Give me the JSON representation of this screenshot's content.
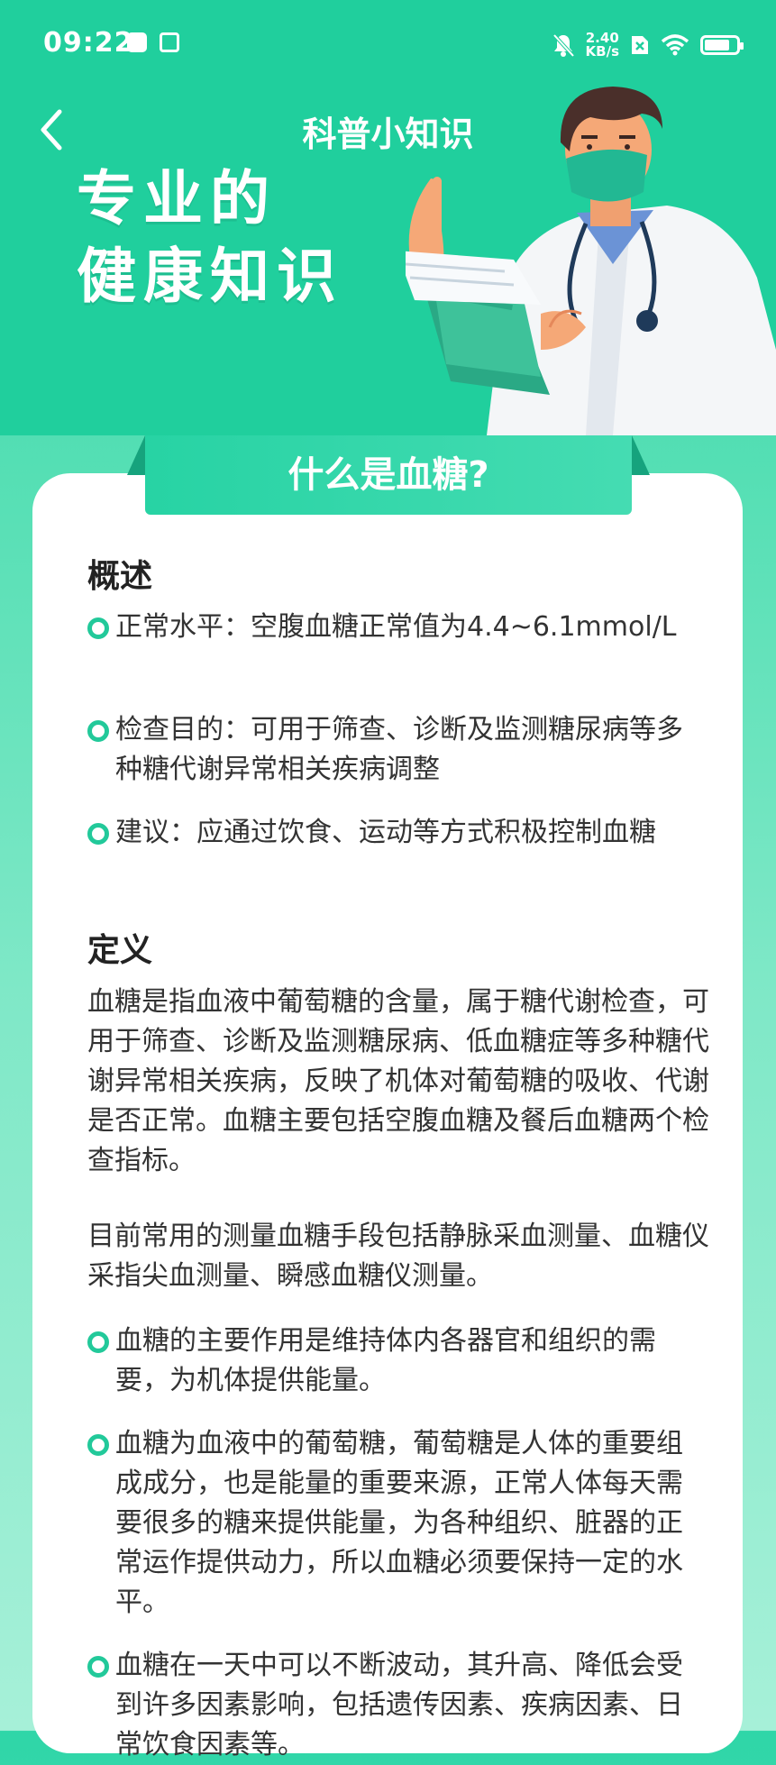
{
  "status_bar": {
    "time": "09:22",
    "speed_value": "2.40",
    "speed_unit": "KB/s",
    "battery_level": 0.8
  },
  "nav": {
    "title": "科普小知识",
    "back_icon": "chevron-left-icon"
  },
  "hero": {
    "slogan_line1": "专业的",
    "slogan_line2": "健康知识"
  },
  "article": {
    "title": "什么是血糖?",
    "overview_heading": "概述",
    "overview_items": [
      "正常水平：空腹血糖正常值为4.4~6.1mmol/L",
      "检查目的：可用于筛查、诊断及监测糖尿病等多种糖代谢异常相关疾病调整",
      "建议：应通过饮食、运动等方式积极控制血糖"
    ],
    "definition_heading": "定义",
    "definition_para1": "血糖是指血液中葡萄糖的含量，属于糖代谢检查，可用于筛查、诊断及监测糖尿病、低血糖症等多种糖代谢异常相关疾病，反映了机体对葡萄糖的吸收、代谢是否正常。血糖主要包括空腹血糖及餐后血糖两个检查指标。",
    "definition_para2": "目前常用的测量血糖手段包括静脉采血测量、血糖仪采指尖血测量、瞬感血糖仪测量。",
    "definition_items": [
      "血糖的主要作用是维持体内各器官和组织的需要，为机体提供能量。",
      "血糖为血液中的葡萄糖，葡萄糖是人体的重要组成成分，也是能量的重要来源，正常人体每天需要很多的糖来提供能量，为各种组织、脏器的正常运作提供动力，所以血糖必须要保持一定的水平。",
      "血糖在一天中可以不断波动，其升高、降低会受到许多因素影响，包括遗传因素、疾病因素、日常饮食因素等。"
    ]
  },
  "colors": {
    "brand_green": "#20cf9d",
    "bullet_ring": "#22c99a"
  }
}
